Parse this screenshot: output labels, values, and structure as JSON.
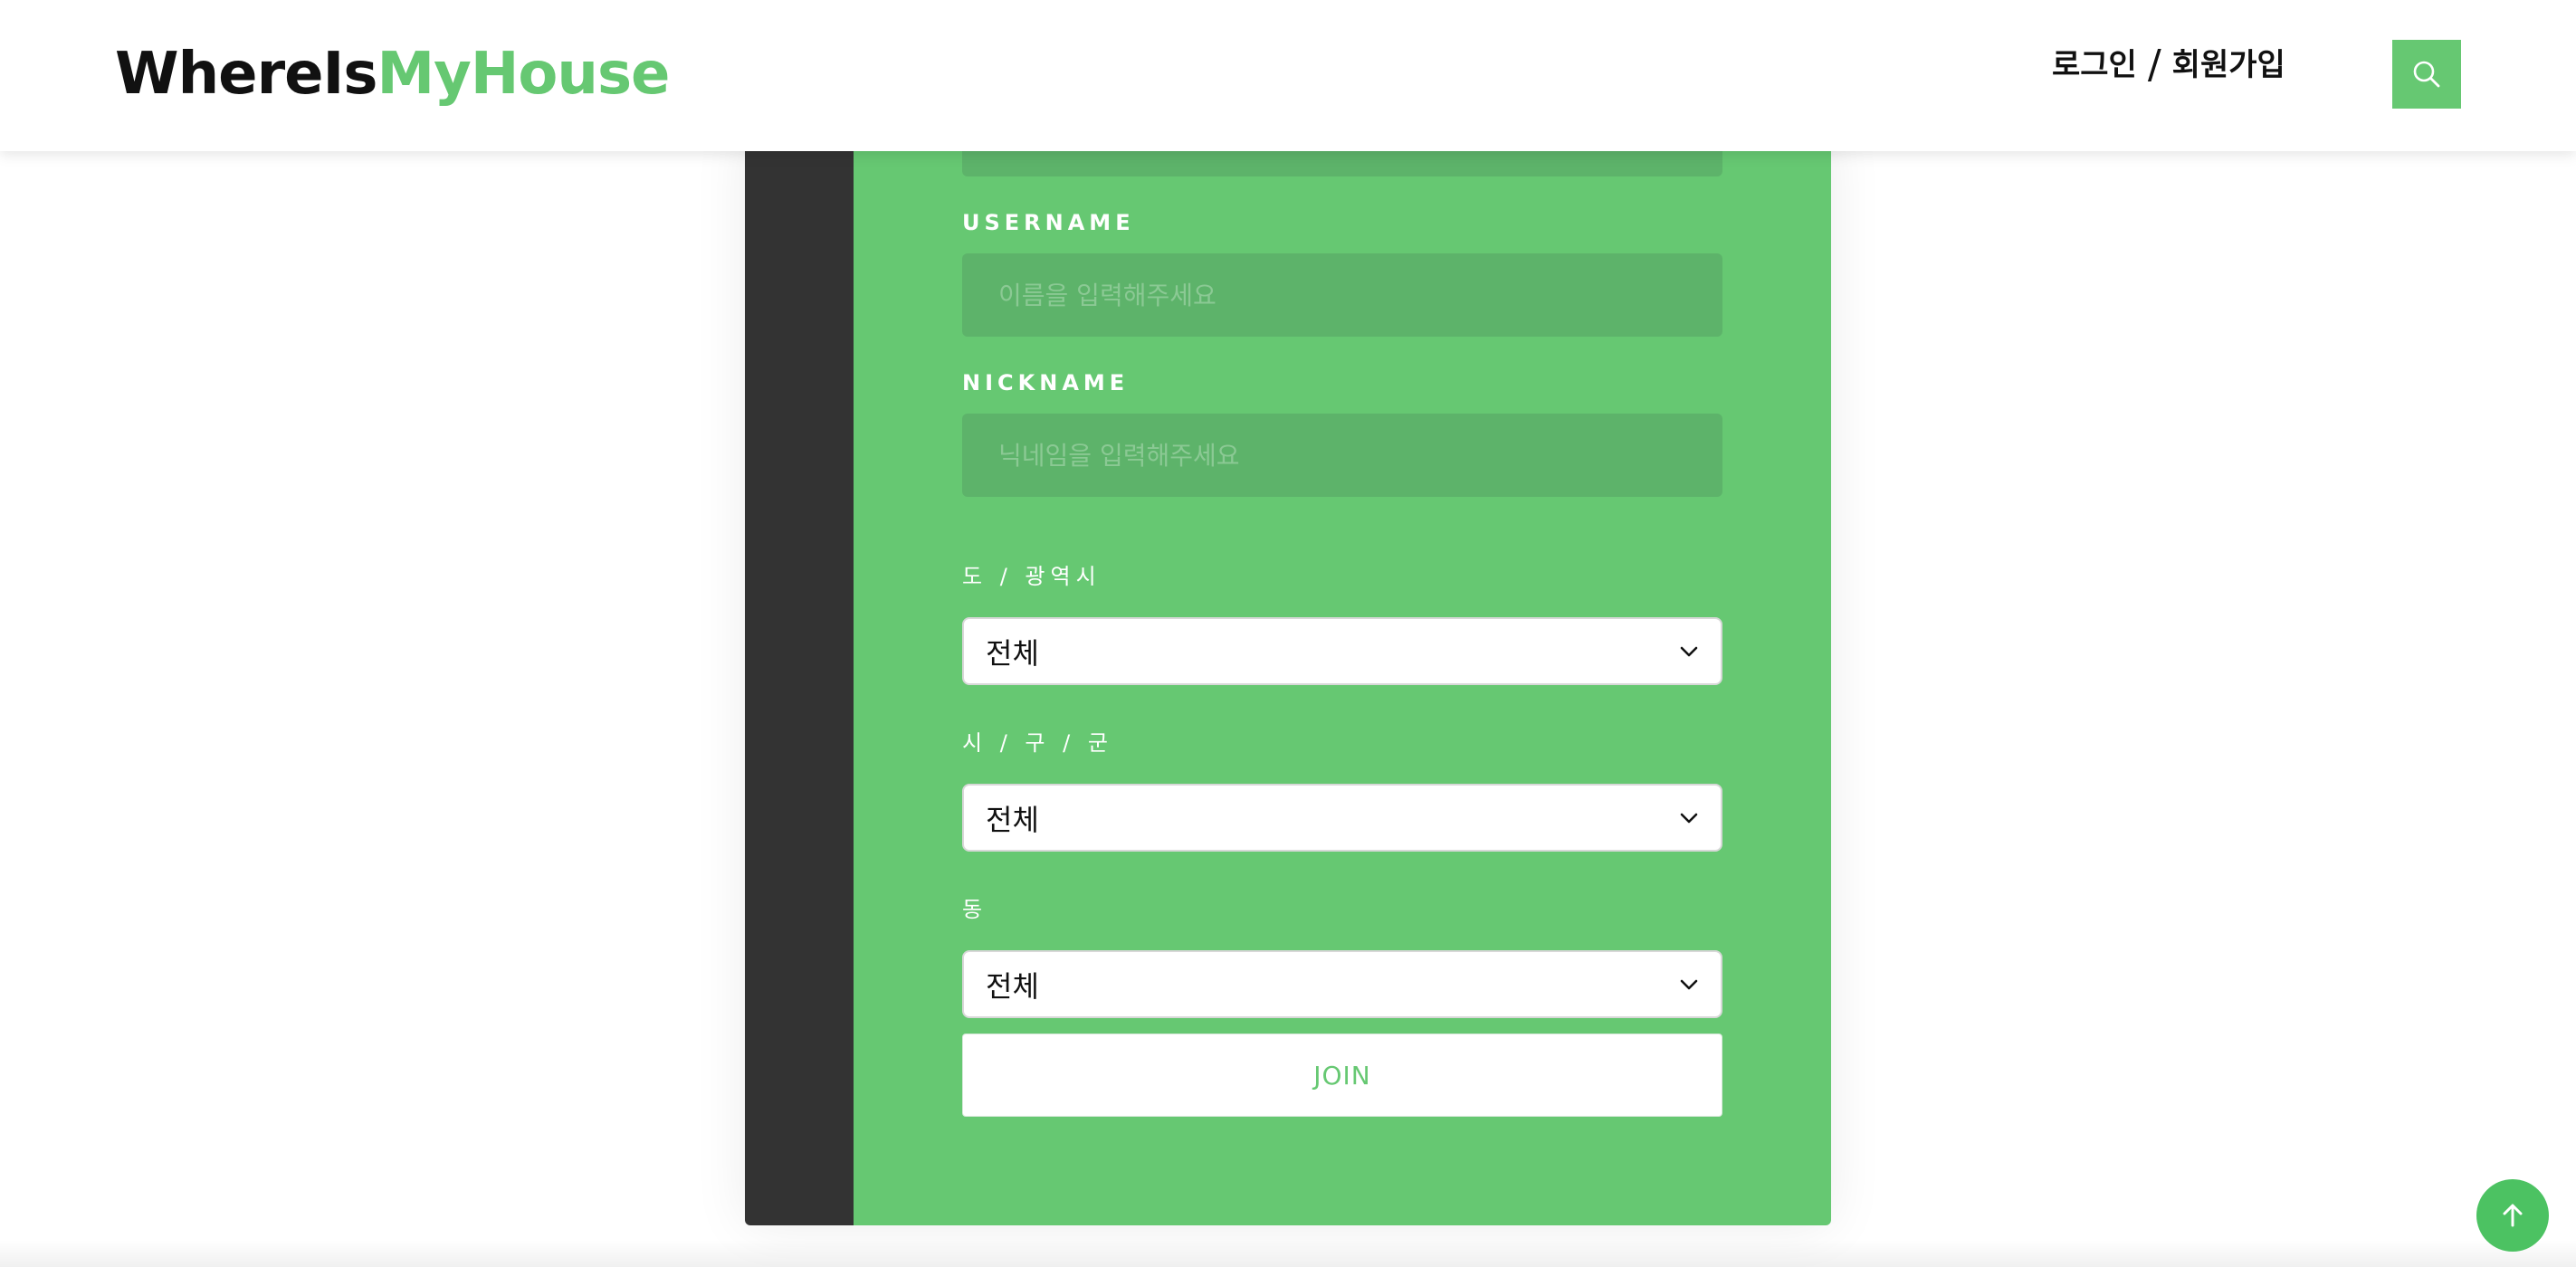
{
  "header": {
    "logo_part1": "WhereIs",
    "logo_part2": "MyHouse",
    "login_label": "로그인",
    "separator": "/",
    "signup_label": "회원가입",
    "search_icon": "search-icon"
  },
  "form": {
    "username": {
      "label": "USERNAME",
      "placeholder": "이름을 입력해주세요",
      "value": ""
    },
    "nickname": {
      "label": "NICKNAME",
      "placeholder": "닉네임을 입력해주세요",
      "value": ""
    },
    "sido": {
      "label": "도 / 광역시",
      "selected": "전체"
    },
    "gugun": {
      "label": "시 / 구 / 군",
      "selected": "전체"
    },
    "dong": {
      "label": "동",
      "selected": "전체"
    },
    "submit_label": "JOIN"
  },
  "colors": {
    "accent": "#66c872",
    "field_bg": "#5db36a",
    "dark_strip": "#333333",
    "scroll_top_btn": "#4cc262"
  },
  "scroll_top_icon": "arrow-up-icon"
}
